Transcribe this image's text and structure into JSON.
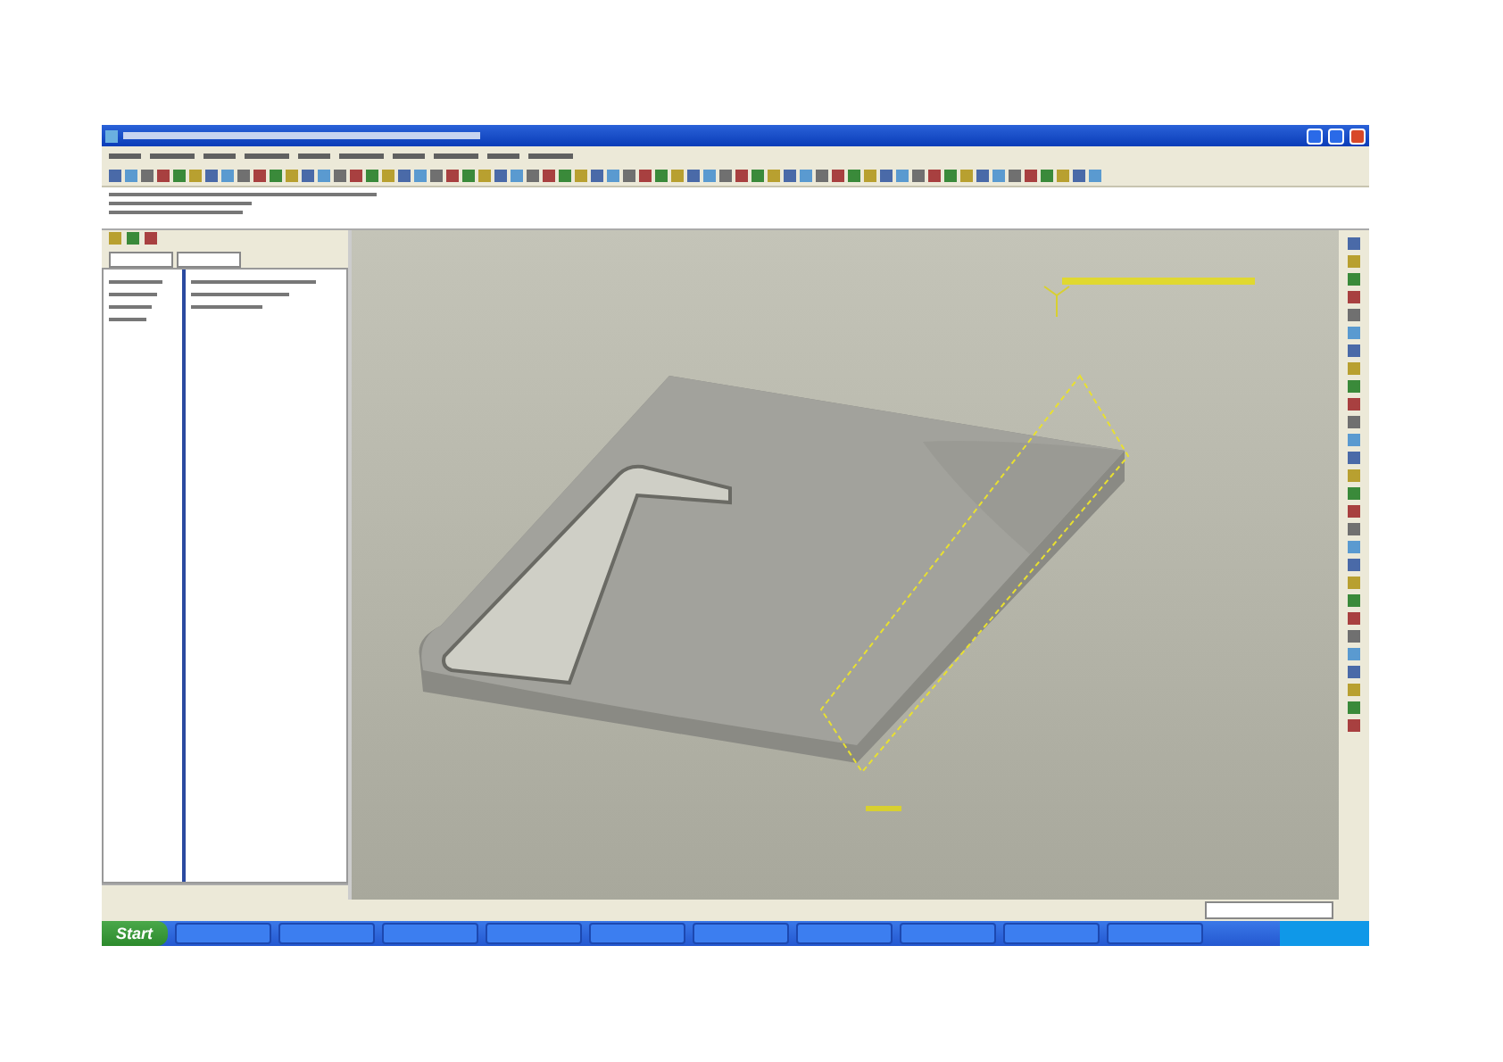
{
  "taskbar": {
    "start_button": "Start"
  }
}
